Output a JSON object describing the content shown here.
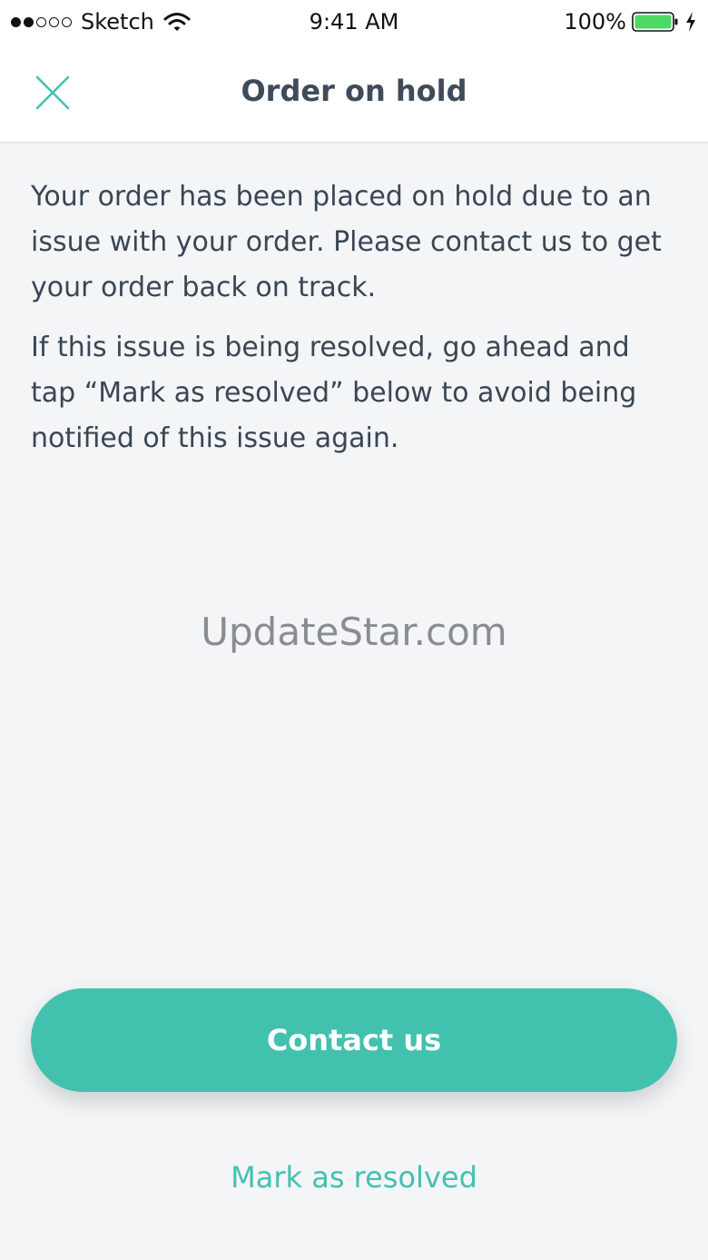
{
  "status_bar": {
    "carrier": "Sketch",
    "time": "9:41 AM",
    "battery": "100%",
    "signal_icon": "signal-dots-icon",
    "wifi_icon": "wifi-icon",
    "battery_icon": "battery-icon",
    "charging_icon": "bolt-icon",
    "battery_color": "#4CD964"
  },
  "nav": {
    "title": "Order on hold",
    "close_icon": "close-icon",
    "close_icon_color": "#43C1AF"
  },
  "message": {
    "paragraph_1": "Your order has been placed on hold due to an issue with your order. Please contact us to get your order back on track.",
    "paragraph_2": "If this issue is being resolved, go ahead and tap “Mark as resolved” below to avoid being notified of this issue again."
  },
  "watermark": "UpdateStar.com",
  "actions": {
    "contact_label": "Contact us",
    "resolve_label": "Mark as resolved",
    "accent_color": "#43C1AF"
  }
}
